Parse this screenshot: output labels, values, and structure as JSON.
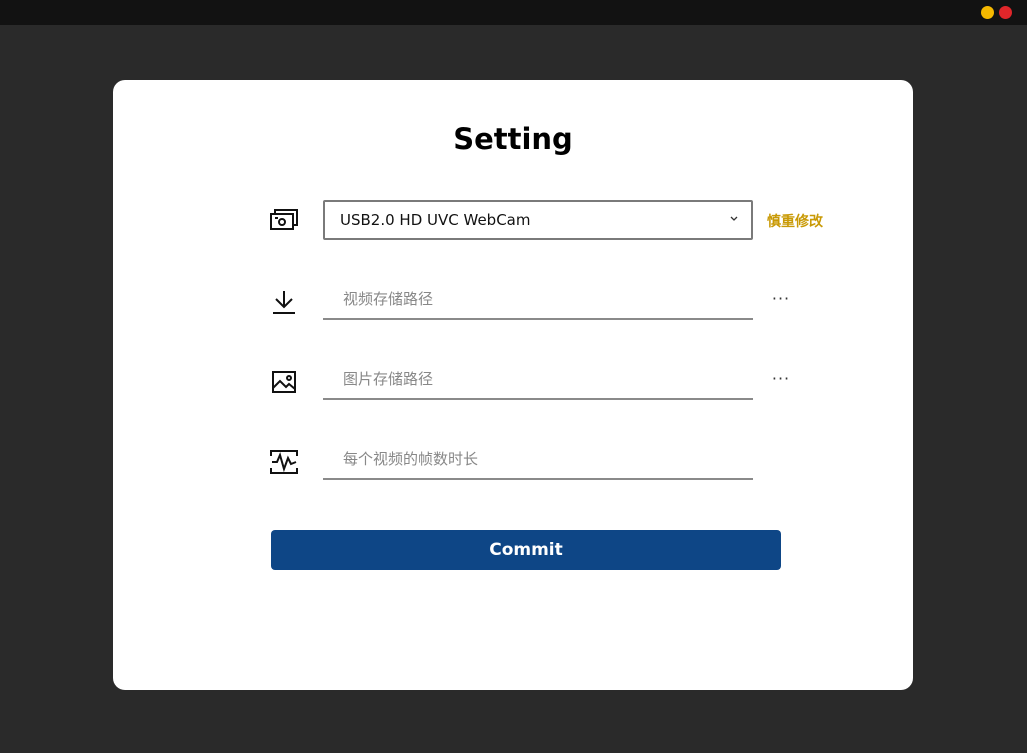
{
  "window": {
    "controls": {
      "minimize_color": "#f5b800",
      "close_color": "#e0262a"
    }
  },
  "settings": {
    "title": "Setting",
    "camera": {
      "icon": "camera-icon",
      "selected": "USB2.0 HD UVC WebCam",
      "warning_link": "慎重修改"
    },
    "video_path": {
      "icon": "download-icon",
      "placeholder": "视频存储路径",
      "browse_label": "···"
    },
    "image_path": {
      "icon": "image-icon",
      "placeholder": "图片存储路径",
      "browse_label": "···"
    },
    "frame_duration": {
      "icon": "waveform-icon",
      "placeholder": "每个视频的帧数时长"
    },
    "commit_label": "Commit"
  },
  "colors": {
    "accent": "#0e4686",
    "warning": "#c99a06",
    "background": "#2a2a2a",
    "card": "#ffffff"
  }
}
